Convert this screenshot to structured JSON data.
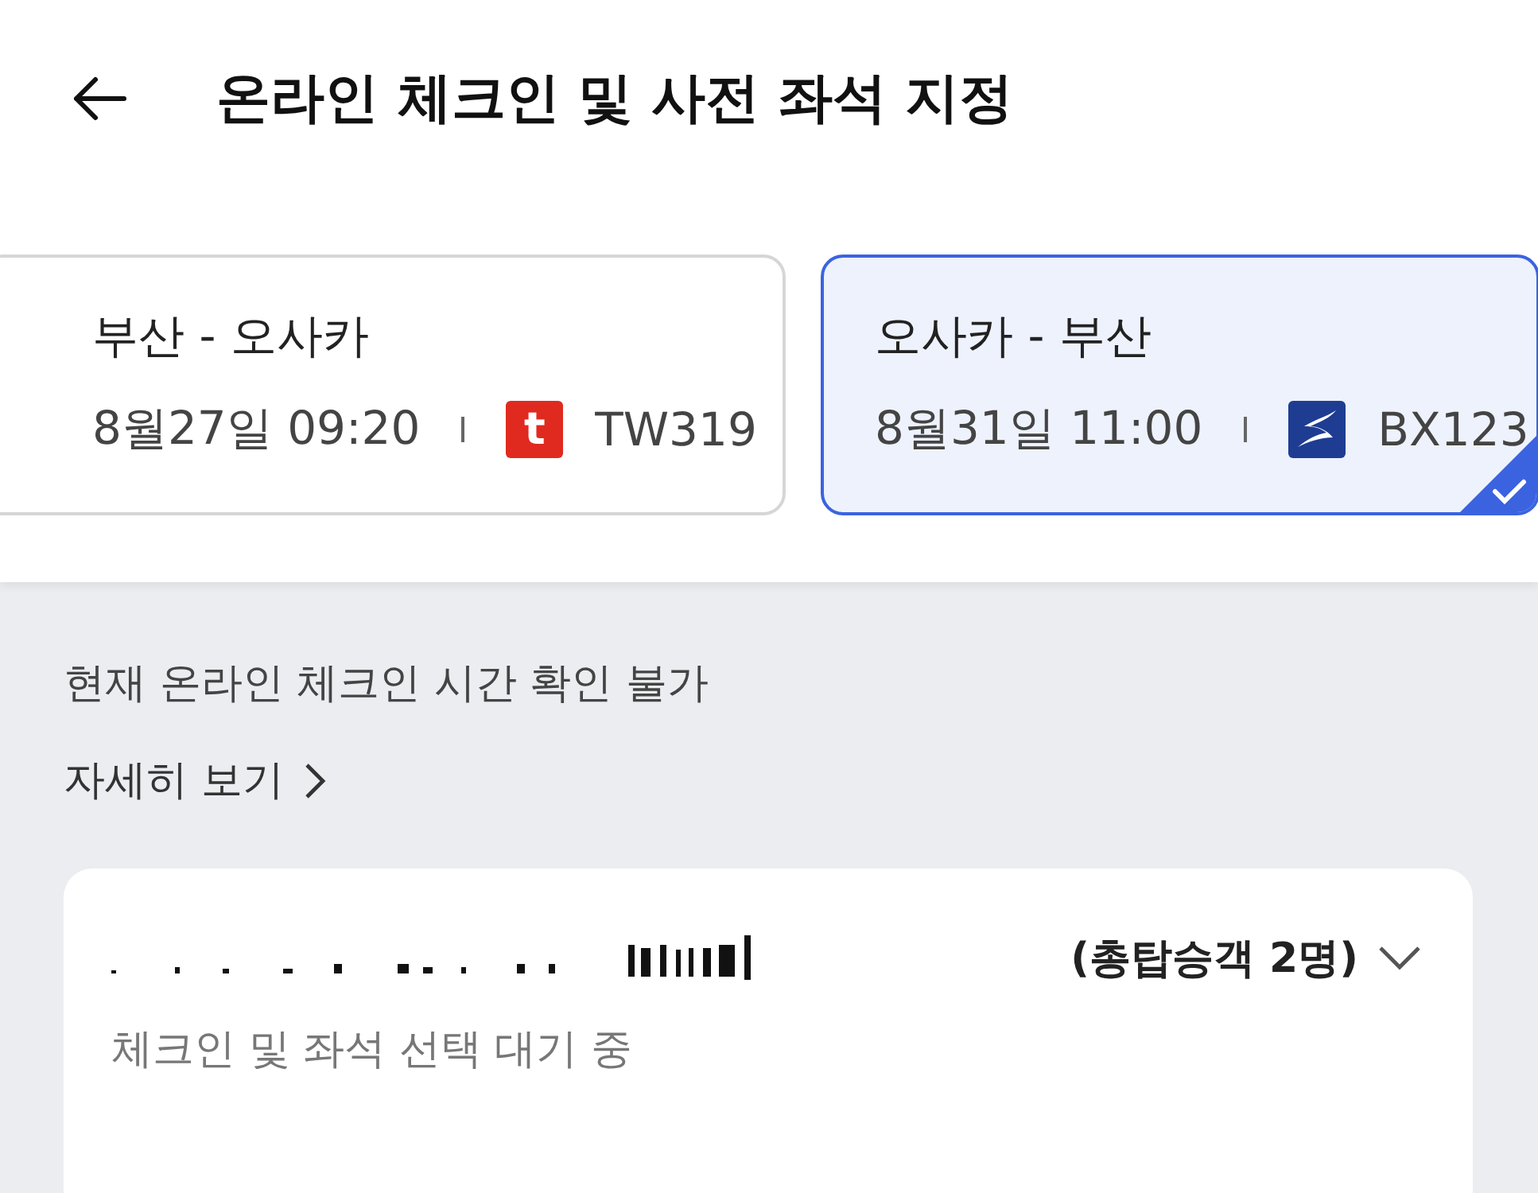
{
  "header": {
    "title": "온라인 체크인 및 사전 좌석 지정"
  },
  "flights": [
    {
      "route": "부산 - 오사카",
      "datetime": "8월27일 09:20",
      "logo": {
        "kind": "letter",
        "text": "t"
      },
      "flight_no": "TW319",
      "selected": false
    },
    {
      "route": "오사카 - 부산",
      "datetime": "8월31일 11:00",
      "logo": {
        "kind": "swoosh"
      },
      "flight_no": "BX123",
      "selected": true
    }
  ],
  "notice": {
    "text": "현재 온라인 체크인 시간 확인 불가",
    "link": "자세히 보기"
  },
  "passenger_card": {
    "total": "(총탑승객 2명)",
    "expanded": false,
    "status": "체크인 및 좌석 선택 대기 중"
  }
}
